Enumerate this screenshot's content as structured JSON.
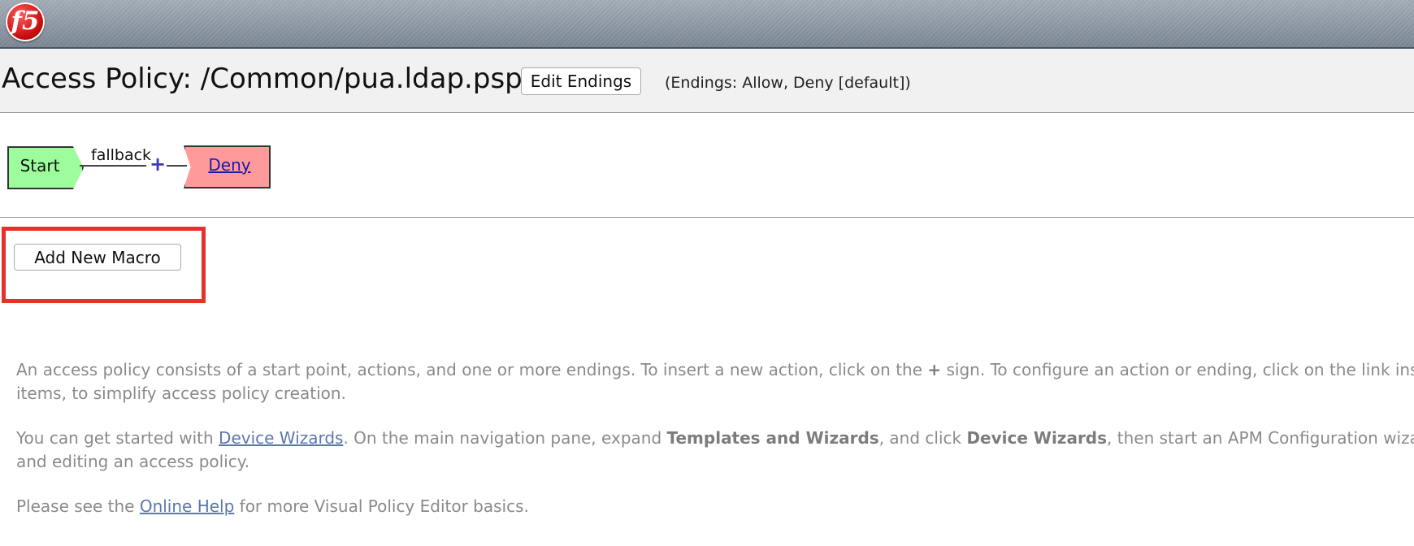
{
  "brand": {
    "logo_text": "f5",
    "logo_color": "#d31515"
  },
  "header": {
    "title": "Access Policy: /Common/pua.ldap.psp",
    "edit_endings_label": "Edit Endings",
    "endings_note": "(Endings: Allow, Deny [default])"
  },
  "flow": {
    "start_label": "Start",
    "branch_label": "fallback",
    "insert_symbol": "+",
    "ending_label": "Deny",
    "start_color": "#9dfd9d",
    "deny_color": "#ff9a9a"
  },
  "macro": {
    "add_label": "Add New Macro",
    "highlight_color": "#e4322b"
  },
  "help": {
    "p1_a": "An access policy consists of a start point, actions, and one or more endings. To insert a new action, click on the ",
    "p1_plus": "+",
    "p1_b": " sign. To configure an action or ending, click on the link inside t",
    "p1_line2": "items, to simplify access policy creation.",
    "p2_a": "You can get started with ",
    "p2_link": "Device Wizards",
    "p2_b": ". On the main navigation pane, expand ",
    "p2_bold1": "Templates and Wizards",
    "p2_c": ", and click ",
    "p2_bold2": "Device Wizards",
    "p2_d": ", then start an APM Configuration wizard, t",
    "p2_line2": "and editing an access policy.",
    "p3_a": "Please see the ",
    "p3_link": "Online Help",
    "p3_b": " for more Visual Policy Editor basics."
  }
}
